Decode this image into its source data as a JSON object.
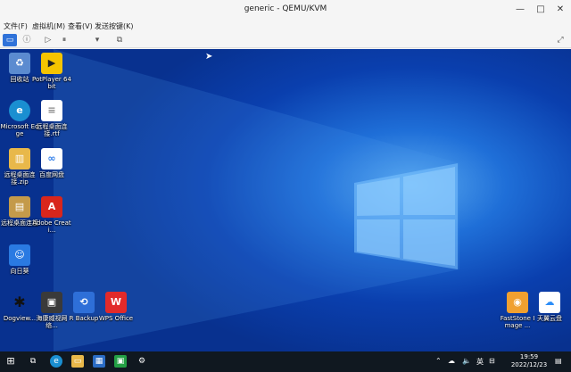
{
  "window": {
    "title": "generic - QEMU/KVM",
    "minimize_glyph": "—",
    "maximize_glyph": "□",
    "close_glyph": "✕"
  },
  "menu": {
    "items": [
      "文件(F)",
      "虚拟机(M)",
      "查看(V)",
      "发送按键(K)"
    ]
  },
  "desktop_icons": [
    {
      "label": "回收站",
      "icon": "recycle-bin-icon"
    },
    {
      "label": "PotPlayer 64 bit",
      "icon": "potplayer-icon"
    },
    {
      "label": "Microsoft Edge",
      "icon": "edge-icon"
    },
    {
      "label": "远程桌面连接.rtf",
      "icon": "document-icon"
    },
    {
      "label": "远程桌面连接.zip",
      "icon": "zip-icon"
    },
    {
      "label": "百度网盘",
      "icon": "baidu-netdisk-icon"
    },
    {
      "label": "远程桌面连接",
      "icon": "archive-icon"
    },
    {
      "label": "Adobe Creati...",
      "icon": "adobe-icon"
    },
    {
      "label": "向日葵",
      "icon": "sunlogin-icon"
    },
    {
      "label": "Dogview...",
      "icon": "dogview-icon"
    },
    {
      "label": "海康威视网络...",
      "icon": "hikvision-icon"
    },
    {
      "label": "R Backup",
      "icon": "backup-icon"
    },
    {
      "label": "WPS Office",
      "icon": "wps-icon"
    },
    {
      "label": "FastStone Image ...",
      "icon": "faststone-icon"
    },
    {
      "label": "天翼云盘",
      "icon": "cloud-drive-icon"
    }
  ],
  "taskbar": {
    "tray_lang": "英",
    "time": "19:59",
    "date": "2022/12/23"
  }
}
